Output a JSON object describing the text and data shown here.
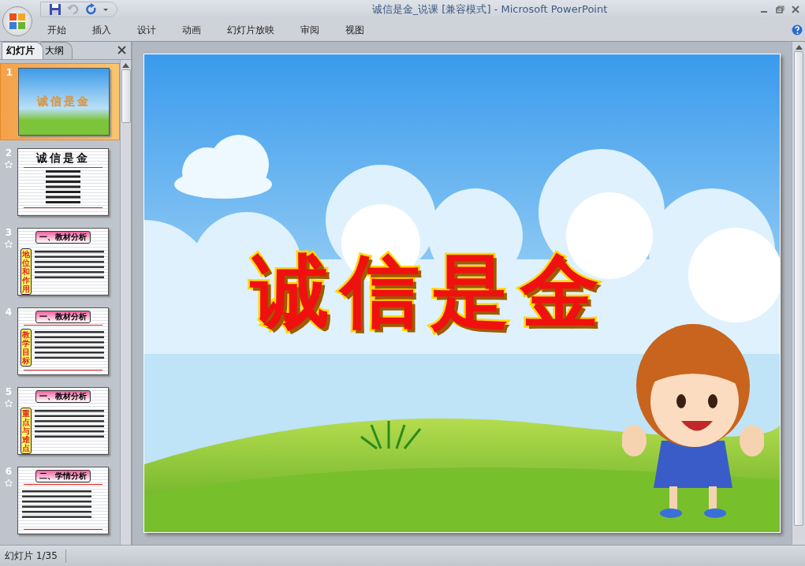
{
  "window": {
    "title": "诚信是金_说课 [兼容模式] - Microsoft PowerPoint"
  },
  "ribbon_tabs": [
    {
      "label": "开始"
    },
    {
      "label": "插入"
    },
    {
      "label": "设计"
    },
    {
      "label": "动画"
    },
    {
      "label": "幻灯片放映"
    },
    {
      "label": "审阅"
    },
    {
      "label": "视图"
    }
  ],
  "pane_tabs": [
    {
      "label": "幻灯片",
      "selected": true
    },
    {
      "label": "大纲",
      "selected": false
    }
  ],
  "slides": [
    {
      "number": "1",
      "kind": "title",
      "title": "诚信是金",
      "selected": true,
      "animated": false
    },
    {
      "number": "2",
      "kind": "contents",
      "title": "诚信是金",
      "selected": false,
      "animated": true
    },
    {
      "number": "3",
      "kind": "section",
      "header": "一、教材分析",
      "side_label": "地位和作用",
      "selected": false,
      "animated": true
    },
    {
      "number": "4",
      "kind": "section",
      "header": "一、教材分析",
      "side_label": "教学目标",
      "selected": false,
      "animated": false
    },
    {
      "number": "5",
      "kind": "section",
      "header": "一、教材分析",
      "side_label": "重点与难点",
      "selected": false,
      "animated": true
    },
    {
      "number": "6",
      "kind": "section",
      "header": "二、学情分析",
      "selected": false,
      "animated": true
    }
  ],
  "slide": {
    "title": "诚信是金"
  },
  "status_bar": {
    "slide_counter": "幻灯片 1/35"
  }
}
